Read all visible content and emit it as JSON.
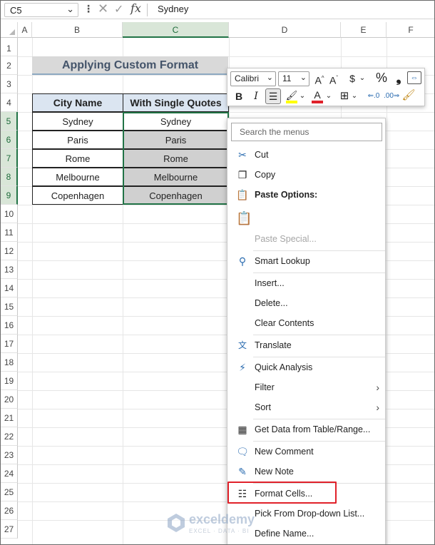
{
  "formula_bar": {
    "name_box": "C5",
    "fx_label": "fx",
    "value": "Sydney"
  },
  "columns": [
    "A",
    "B",
    "C",
    "D",
    "E",
    "F"
  ],
  "rows": [
    "1",
    "2",
    "3",
    "4",
    "5",
    "6",
    "7",
    "8",
    "9",
    "10",
    "11",
    "12",
    "13",
    "14",
    "15",
    "16",
    "17",
    "18",
    "19",
    "20",
    "21",
    "22",
    "23",
    "24",
    "25",
    "26",
    "27"
  ],
  "sheet": {
    "title": "Applying Custom Format",
    "table": {
      "headers": [
        "City Name",
        "With Single Quotes"
      ],
      "rows": [
        [
          "Sydney",
          "Sydney"
        ],
        [
          "Paris",
          "Paris"
        ],
        [
          "Rome",
          "Rome"
        ],
        [
          "Melbourne",
          "Melbourne"
        ],
        [
          "Copenhagen",
          "Copenhagen"
        ]
      ]
    }
  },
  "mini_toolbar": {
    "font_name": "Calibri",
    "font_size": "11",
    "bold": "B",
    "italic": "I",
    "increase_font": "A^",
    "decrease_font": "Aˇ",
    "currency": "$",
    "percent": "%",
    "comma": "9",
    "font_color_letter": "A",
    "highlight_color": "#ffff00",
    "font_color": "#e0212a"
  },
  "context_menu": {
    "search_placeholder": "Search the menus",
    "items": {
      "cut": "Cut",
      "copy": "Copy",
      "paste_options": "Paste Options:",
      "paste_special": "Paste Special...",
      "smart_lookup": "Smart Lookup",
      "insert": "Insert...",
      "delete": "Delete...",
      "clear_contents": "Clear Contents",
      "translate": "Translate",
      "quick_analysis": "Quick Analysis",
      "filter": "Filter",
      "sort": "Sort",
      "get_data": "Get Data from Table/Range...",
      "new_comment": "New Comment",
      "new_note": "New Note",
      "format_cells": "Format Cells...",
      "pick_from_list": "Pick From Drop-down List...",
      "define_name": "Define Name..."
    }
  },
  "watermark": {
    "name": "exceldemy",
    "tagline": "EXCEL · DATA · BI"
  },
  "colors": {
    "selection_green": "#217346",
    "highlight_red": "#e0212a",
    "header_blue": "#dbe5f1",
    "title_gray": "#d9d9d9"
  }
}
